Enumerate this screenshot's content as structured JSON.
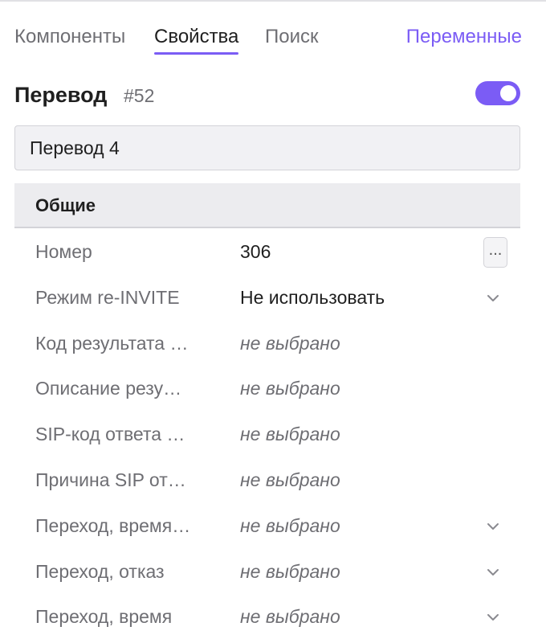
{
  "tabs": {
    "components": "Компоненты",
    "properties": "Свойства",
    "search": "Поиск",
    "variables": "Переменные"
  },
  "header": {
    "title": "Перевод",
    "number": "#52",
    "enabled": true
  },
  "name_field": {
    "value": "Перевод 4"
  },
  "section": {
    "title": "Общие"
  },
  "rows": [
    {
      "label": "Номер",
      "value": "306",
      "control": "more",
      "more_label": "..."
    },
    {
      "label": "Режим re-INVITE",
      "value": "Не использовать",
      "control": "dropdown"
    },
    {
      "label": "Код результата …",
      "value": "не выбрано",
      "control": "none"
    },
    {
      "label": "Описание резу…",
      "value": "не выбрано",
      "control": "none"
    },
    {
      "label": "SIP-код ответа …",
      "value": "не выбрано",
      "control": "none"
    },
    {
      "label": "Причина SIP от…",
      "value": "не выбрано",
      "control": "none"
    },
    {
      "label": "Переход, время…",
      "value": "не выбрано",
      "control": "dropdown"
    },
    {
      "label": "Переход, отказ",
      "value": "не выбрано",
      "control": "dropdown"
    },
    {
      "label": "Переход, время",
      "value": "не выбрано",
      "control": "dropdown"
    }
  ],
  "colors": {
    "accent": "#7b5cf5",
    "muted_text": "#6e6e73",
    "section_bg": "#ececef"
  },
  "icons": {
    "dropdown": "chevron-down-icon",
    "more": "ellipsis-icon"
  }
}
